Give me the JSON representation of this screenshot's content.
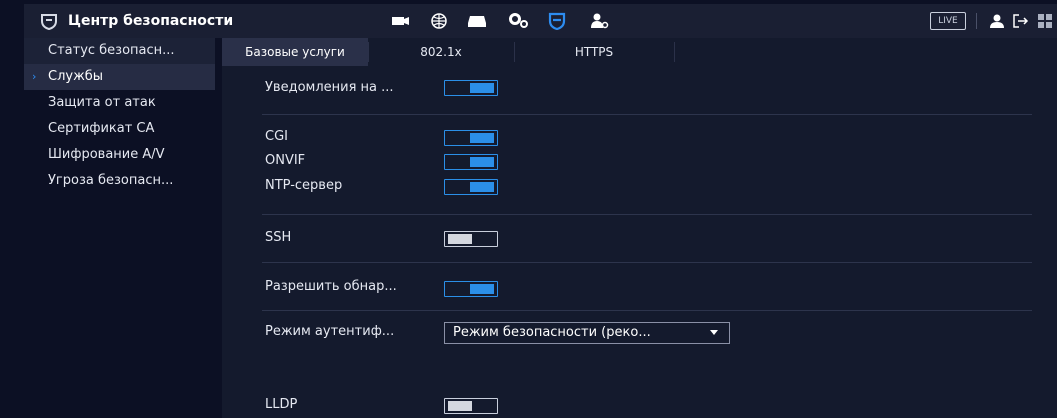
{
  "topbar": {
    "title": "Центр безопасности",
    "live_label": "LIVE",
    "icons": [
      "shield-icon",
      "camera-icon",
      "network-icon",
      "storage-icon",
      "system-settings-icon",
      "security-shield-icon",
      "account-icon",
      "user-icon",
      "logout-icon",
      "grid-icon"
    ],
    "active_icon": "security-shield-icon",
    "accent_color": "#2d8cf0"
  },
  "sidebar": {
    "items": [
      {
        "label": "Статус безопасн..."
      },
      {
        "label": "Службы"
      },
      {
        "label": "Защита от атак"
      },
      {
        "label": "Сертификат CA"
      },
      {
        "label": "Шифрование A/V"
      },
      {
        "label": "Угроза безопасн..."
      }
    ],
    "active_index": 1
  },
  "tabs": [
    {
      "label": "Базовые услуги"
    },
    {
      "label": "802.1x"
    },
    {
      "label": "HTTPS"
    }
  ],
  "active_tab": 0,
  "settings": {
    "notifications": {
      "label": "Уведомления на ...",
      "enabled": true
    },
    "cgi": {
      "label": "CGI",
      "enabled": true
    },
    "onvif": {
      "label": "ONVIF",
      "enabled": true
    },
    "ntp": {
      "label": "NTP-сервер",
      "enabled": true
    },
    "ssh": {
      "label": "SSH",
      "enabled": false
    },
    "discovery": {
      "label": "Разрешить обнар...",
      "enabled": true
    },
    "auth_mode": {
      "label": "Режим аутентиф...",
      "value": "Режим безопасности (реко..."
    },
    "lldp": {
      "label": "LLDP",
      "enabled": false
    }
  },
  "colors": {
    "toggle_on": "#2b8fe8",
    "toggle_off": "#d4d7df"
  }
}
